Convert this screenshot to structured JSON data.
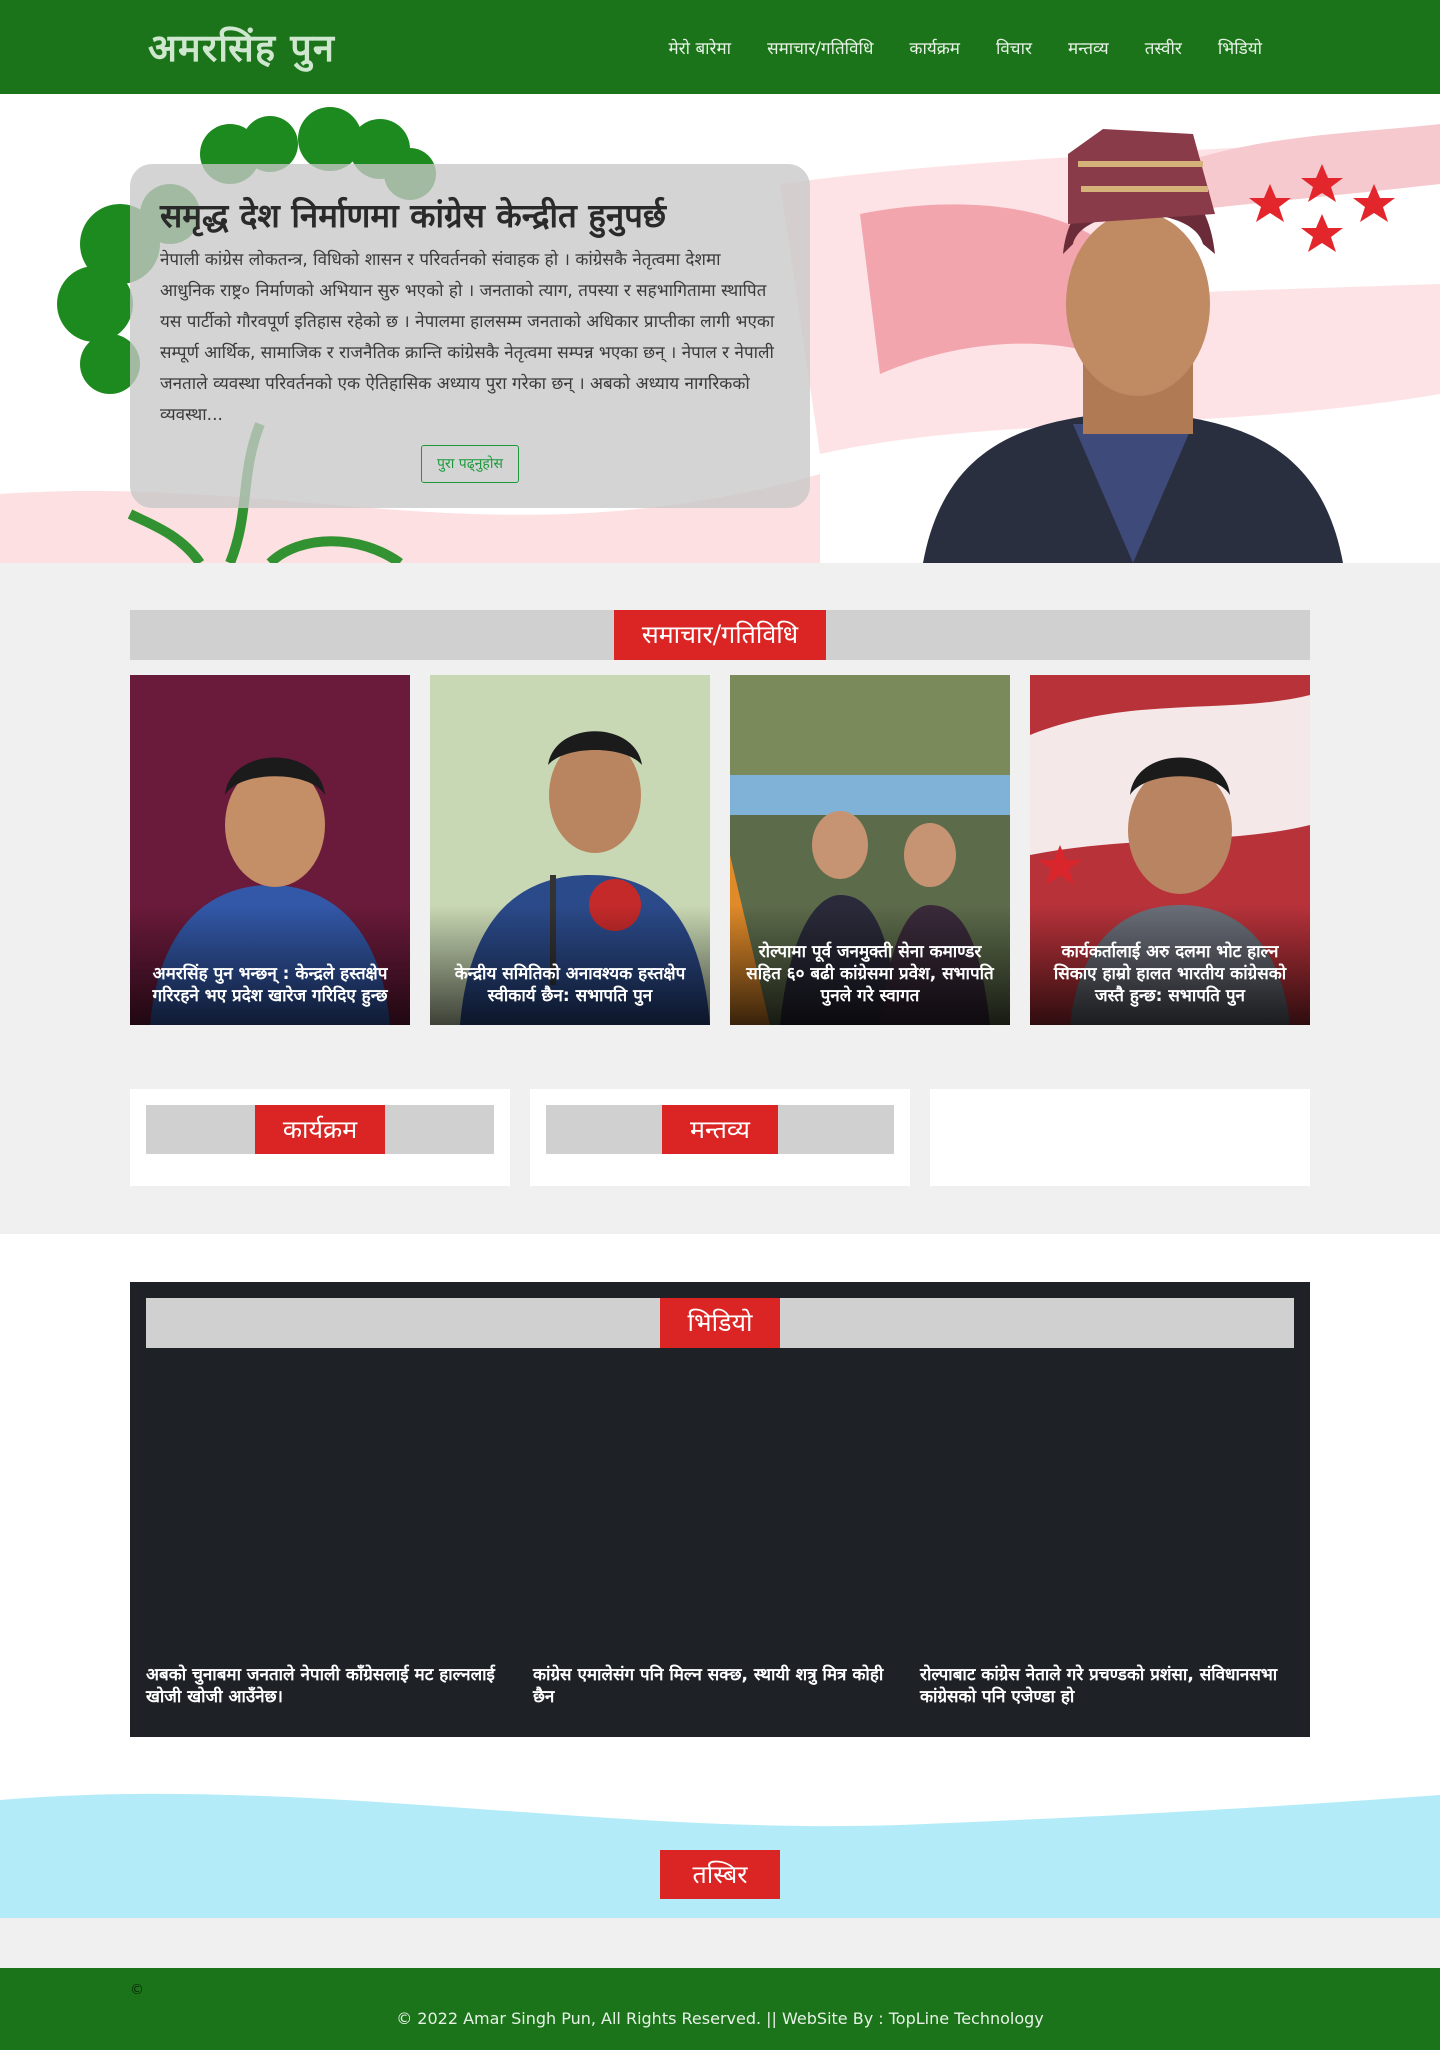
{
  "brand": "अमरसिंह पुन",
  "nav": [
    "मेरो बारेमा",
    "समाचार/गतिविधि",
    "कार्यक्रम",
    "विचार",
    "मन्तव्य",
    "तस्वीर",
    "भिडियो"
  ],
  "hero": {
    "title": "समृद्ध देश निर्माणमा कांग्रेस केन्द्रीत हुनुपर्छ",
    "text": "नेपाली कांग्रेस लोकतन्त्र, विधिको शासन र परिवर्तनको संवाहक हो । कांग्रेसकै नेतृत्वमा देशमा आधुनिक राष्ट्र० निर्माणको अभियान सुरु भएको हो । जनताको त्याग, तपस्या र सहभागितामा स्थापित यस पार्टीको गौरवपूर्ण इतिहास रहेको छ । नेपालमा हालसम्म जनताको अधिकार प्राप्तीका लागी भएका सम्पूर्ण आर्थिक, सामाजिक र राजनैतिक क्रान्ति कांग्रेसकै नेतृत्वमा सम्पन्न भएका छन् । नेपाल र नेपाली जनताले व्यवस्था परिवर्तनको एक ऐतिहासिक अध्याय पुरा गरेका छन् । अबको अध्याय नागरिकको व्यवस्था...",
    "button": "पुरा पढ्नुहोस"
  },
  "news": {
    "heading": "समाचार/गतिविधि",
    "items": [
      {
        "caption": "अमरसिंह पुन भन्छन् : केन्द्रले हस्तक्षेप गरिरहने भए प्रदेश खारेज गरिदिए हुन्छ",
        "bg": "#6a1a3a"
      },
      {
        "caption": "केन्द्रीय समितिको अनावश्यक हस्तक्षेप स्वीकार्य छैन: सभापति पुन",
        "bg": "#c9d8b4"
      },
      {
        "caption": "रोल्पामा पूर्व जनमुक्ती सेना कमाण्डर सहित ६० बढी कांग्रेसमा प्रवेश, सभापति पुनले गरे स्वागत",
        "bg": "#5c6b4a"
      },
      {
        "caption": "कार्यकर्तालाई अरु दलमा भोट हाल्न सिकाए हाम्रो हालत भारतीय कांग्रेसको जस्तै हुन्छ: सभापति पुन",
        "bg": "#b8323a"
      }
    ]
  },
  "widgets": {
    "program": "कार्यक्रम",
    "statement": "मन्तव्य"
  },
  "video": {
    "heading": "भिडियो",
    "items": [
      "अबको चुनाबमा जनताले नेपाली काँग्रेसलाई मट हाल्नलाई खोजी खोजी आउँनेछ।",
      "कांग्रेस एमालेसंग पनि मिल्न सक्छ, स्थायी शत्रु मित्र कोही छैन",
      "रोल्पाबाट कांग्रेस नेताले गरे प्रचण्डको प्रशंसा, संविधानसभा कांग्रेसको पनि एजेण्डा हो"
    ]
  },
  "gallery": {
    "heading": "तस्बिर"
  },
  "footer": {
    "icon": "©",
    "text": "© 2022 Amar Singh Pun, All Rights Reserved. || WebSite By : TopLine Technology"
  },
  "colors": {
    "green": "#1b7419",
    "red": "#db2524",
    "bar": "#d0d0d0",
    "dark": "#1e2227",
    "wave": "#b3ecf8"
  }
}
